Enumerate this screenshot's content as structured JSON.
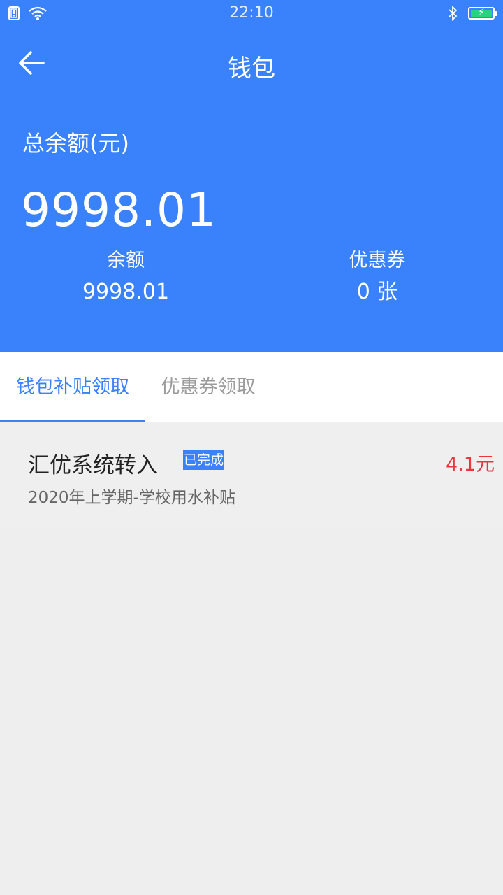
{
  "status_bar": {
    "time": "22:10",
    "icons": [
      "sim-icon",
      "wifi-icon",
      "bluetooth-icon",
      "battery-charging-icon"
    ]
  },
  "header": {
    "title": "钱包",
    "back_icon": "arrow-left-icon",
    "total_label": "总余额(元)",
    "total_amount": "9998.01",
    "stats": [
      {
        "label": "余额",
        "value": "9998.01"
      },
      {
        "label": "优惠券",
        "value": "0 张"
      }
    ]
  },
  "tabs": [
    {
      "label": "钱包补贴领取",
      "active": true
    },
    {
      "label": "优惠券领取",
      "active": false
    }
  ],
  "records": [
    {
      "title": "汇优系统转入",
      "status": "已完成",
      "amount": "4.1元",
      "description": "2020年上学期-学校用水补贴"
    }
  ],
  "colors": {
    "primary": "#3a82fb",
    "amount_red": "#e8353e",
    "background": "#eeeeee",
    "battery_green": "#29d37a"
  }
}
